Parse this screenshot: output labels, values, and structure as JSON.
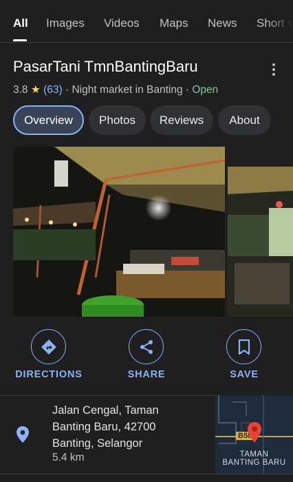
{
  "tabs": {
    "all": "All",
    "images": "Images",
    "videos": "Videos",
    "maps": "Maps",
    "news": "News",
    "short": "Short v"
  },
  "place": {
    "name": "PasarTani TmnBantingBaru",
    "rating": "3.8",
    "star": "★",
    "review_count": "(63)",
    "category": "· Night market in Banting ·",
    "status": "Open"
  },
  "chips": {
    "overview": "Overview",
    "photos": "Photos",
    "reviews": "Reviews",
    "about": "About"
  },
  "actions": {
    "directions": "DIRECTIONS",
    "share": "SHARE",
    "save": "SAVE"
  },
  "address": {
    "line1": "Jalan Cengal, Taman",
    "line2": "Banting Baru, 42700",
    "line3": "Banting, Selangor",
    "distance": "5.4 km"
  },
  "map": {
    "road_label": "B58",
    "area_line1": "TAMAN",
    "area_line2": "BANTING BARU"
  },
  "colors": {
    "background": "#1f1f1f",
    "accent": "#8ab4f8",
    "open": "#81c995",
    "star": "#fdd663",
    "pin": "#ea4335"
  }
}
